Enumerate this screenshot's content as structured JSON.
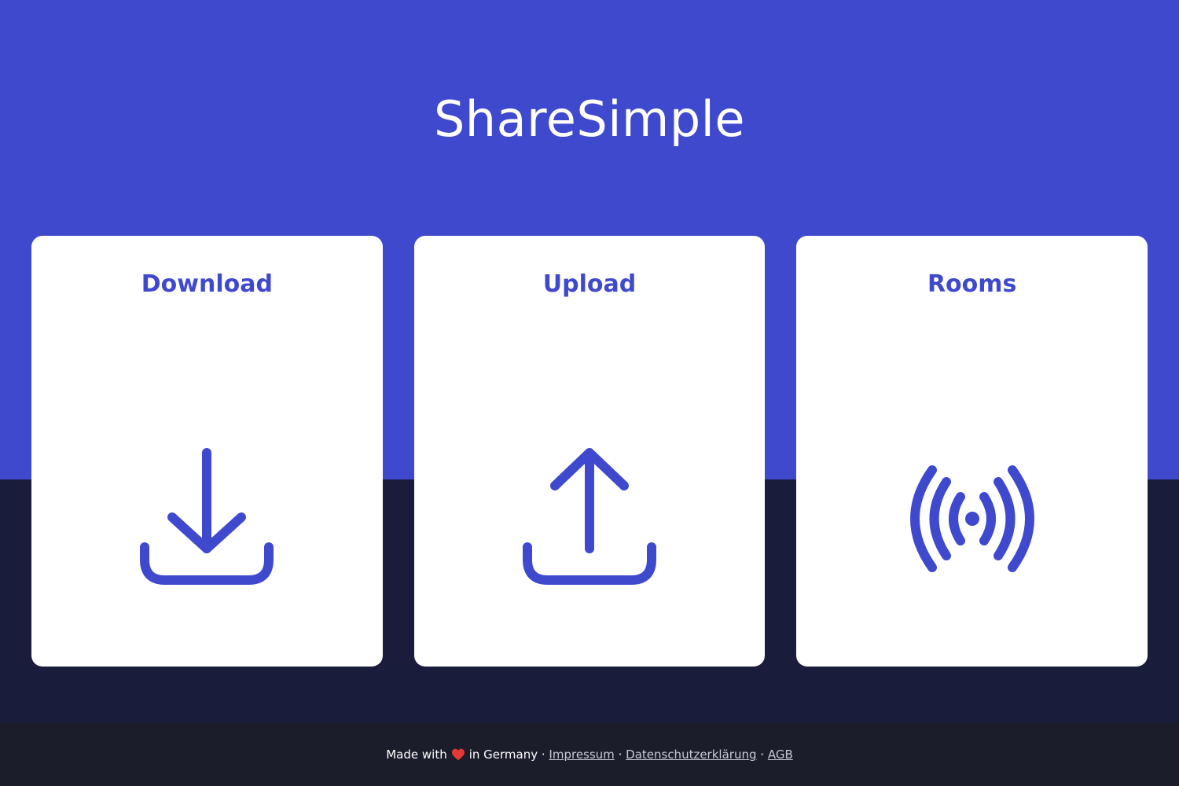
{
  "header": {
    "title": "ShareSimple"
  },
  "cards": [
    {
      "label": "Download",
      "icon": "download-icon"
    },
    {
      "label": "Upload",
      "icon": "upload-icon"
    },
    {
      "label": "Rooms",
      "icon": "broadcast-icon"
    }
  ],
  "footer": {
    "made_with": "Made with",
    "heart_icon": "heart-icon",
    "in_country": "in Germany ·",
    "link_impressum": "Impressum",
    "sep": "·",
    "link_privacy": "Datenschutzerklärung",
    "link_terms": "AGB"
  },
  "colors": {
    "brand": "#3f49ce",
    "dark_background": "#1a1c3b",
    "footer_background": "#1b1d2b",
    "card_background": "#ffffff",
    "heart": "#e53935"
  }
}
